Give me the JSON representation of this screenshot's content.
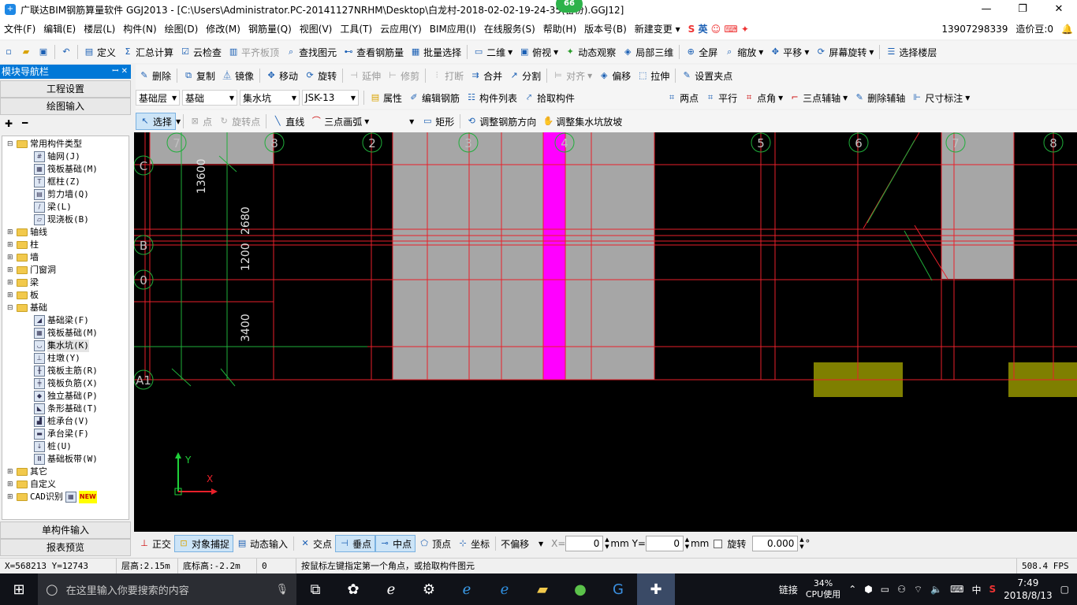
{
  "window": {
    "title": "广联达BIM钢筋算量软件 GGJ2013 - [C:\\Users\\Administrator.PC-20141127NRHM\\Desktop\\白龙村-2018-02-02-19-24-35(备份).GGJ12]",
    "badge": "66",
    "min": "—",
    "max": "❐",
    "close": "✕"
  },
  "menu": [
    "文件(F)",
    "编辑(E)",
    "楼层(L)",
    "构件(N)",
    "绘图(D)",
    "修改(M)",
    "钢筋量(Q)",
    "视图(V)",
    "工具(T)",
    "云应用(Y)",
    "BIM应用(I)",
    "在线服务(S)",
    "帮助(H)",
    "版本号(B)",
    "新建变更 ▾"
  ],
  "menu_right": {
    "phone": "13907298339",
    "price": "造价豆:0",
    "ime": "英"
  },
  "toolbar1": [
    "定义",
    "汇总计算",
    "云检查",
    "平齐板顶",
    "查找图元",
    "查看钢筋量",
    "批量选择",
    "二维",
    "俯视",
    "动态观察",
    "局部三维",
    "全屏",
    "缩放",
    "平移",
    "屏幕旋转",
    "选择楼层"
  ],
  "toolbar2": [
    "删除",
    "复制",
    "镜像",
    "移动",
    "旋转",
    "延伸",
    "修剪",
    "打断",
    "合并",
    "分割",
    "对齐",
    "偏移",
    "拉伸",
    "设置夹点"
  ],
  "toolbar3": {
    "floor_select": "基础层",
    "type_select": "基础",
    "element_select": "集水坑",
    "name_select": "JSK-13",
    "buttons": [
      "属性",
      "编辑钢筋",
      "构件列表",
      "拾取构件"
    ],
    "axis_buttons": [
      "两点",
      "平行",
      "点角",
      "三点辅轴",
      "删除辅轴",
      "尺寸标注"
    ]
  },
  "toolbar4": [
    "选择",
    "点",
    "旋转点",
    "直线",
    "三点画弧",
    "矩形",
    "调整钢筋方向",
    "调整集水坑放坡"
  ],
  "nav": {
    "title": "模块导航栏",
    "pins": "ꟷ ✕",
    "project_settings": "工程设置",
    "drawing_input": "绘图输入",
    "single_input": "单构件输入",
    "report_preview": "报表预览"
  },
  "tree": {
    "common": "常用构件类型",
    "common_items": [
      "轴网(J)",
      "筏板基础(M)",
      "框柱(Z)",
      "剪力墙(Q)",
      "梁(L)",
      "现浇板(B)"
    ],
    "groups": [
      "轴线",
      "柱",
      "墙",
      "门窗洞",
      "梁",
      "板"
    ],
    "foundation": "基础",
    "foundation_items": [
      "基础梁(F)",
      "筏板基础(M)",
      "集水坑(K)",
      "柱墩(Y)",
      "筏板主筋(R)",
      "筏板负筋(X)",
      "独立基础(P)",
      "条形基础(T)",
      "桩承台(V)",
      "承台梁(F)",
      "桩(U)",
      "基础板带(W)"
    ],
    "tail": [
      "其它",
      "自定义",
      "CAD识别"
    ],
    "new_tag": "NEW"
  },
  "canvas": {
    "axis_top": [
      "7",
      "8",
      "2",
      "3",
      "4",
      "5",
      "6",
      "7",
      "8"
    ],
    "axis_left": [
      "C",
      "B",
      "0",
      "A1"
    ],
    "dims": [
      "13600",
      "1200",
      "2680",
      "3400"
    ],
    "ucs_y": "Y",
    "ucs_x": "X"
  },
  "bottom": {
    "buttons": [
      "正交",
      "对象捕捉",
      "动态输入",
      "交点",
      "垂点",
      "中点",
      "顶点",
      "坐标"
    ],
    "offset_select": "不偏移",
    "x_label": "X=",
    "x_value": "0",
    "y_label": "mm Y=",
    "y_value": "0",
    "mm": "mm",
    "rotate_label": "旋转",
    "rotate_value": "0.000",
    "deg": "°"
  },
  "status": {
    "coords": "X=568213 Y=12743",
    "floor_height": "层高:2.15m",
    "bottom_height": "底标高:-2.2m",
    "zero": "0",
    "hint": "按鼠标左键指定第一个角点，或拾取构件图元",
    "fps": "508.4 FPS"
  },
  "taskbar": {
    "search_placeholder": "在这里输入你要搜索的内容",
    "network": "链接",
    "cpu_pct": "34%",
    "cpu_label": "CPU使用",
    "lang": "中",
    "time": "7:49",
    "date": "2018/8/13"
  }
}
